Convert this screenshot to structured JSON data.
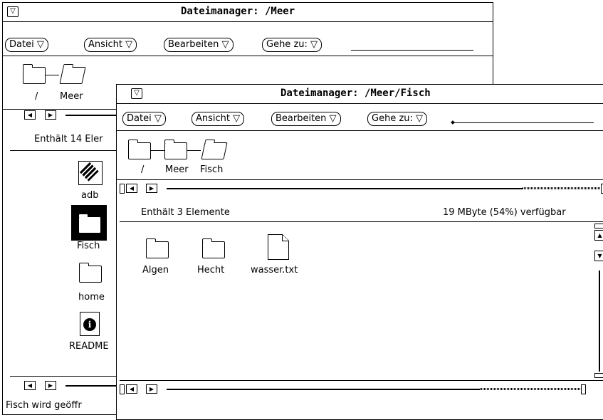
{
  "back_window": {
    "title": "Dateimanager: /Meer",
    "menu": {
      "datei": "Datei ▽",
      "ansicht": "Ansicht ▽",
      "bearbeiten": "Bearbeiten ▽",
      "gehe_zu": "Gehe zu: ▽"
    },
    "path": [
      {
        "label": "/"
      },
      {
        "label": "Meer"
      }
    ],
    "status": "Enthält 14 Eler",
    "files": [
      {
        "name": "adb",
        "icon": "application-icon"
      },
      {
        "name": "Fisch",
        "icon": "folder-icon",
        "selected": true
      },
      {
        "name": "home",
        "icon": "folder-icon"
      },
      {
        "name": "README",
        "icon": "info-document-icon"
      }
    ],
    "footer": "Fisch wird geöffr"
  },
  "front_window": {
    "title": "Dateimanager: /Meer/Fisch",
    "menu": {
      "datei": "Datei ▽",
      "ansicht": "Ansicht ▽",
      "bearbeiten": "Bearbeiten ▽",
      "gehe_zu": "Gehe zu: ▽"
    },
    "path": [
      {
        "label": "/"
      },
      {
        "label": "Meer"
      },
      {
        "label": "Fisch"
      }
    ],
    "status_left": "Enthält 3 Elemente",
    "status_right": "19 MByte (54%) verfügbar",
    "files": [
      {
        "name": "Algen",
        "icon": "folder-icon"
      },
      {
        "name": "Hecht",
        "icon": "folder-icon"
      },
      {
        "name": "wasser.txt",
        "icon": "document-icon"
      }
    ]
  }
}
